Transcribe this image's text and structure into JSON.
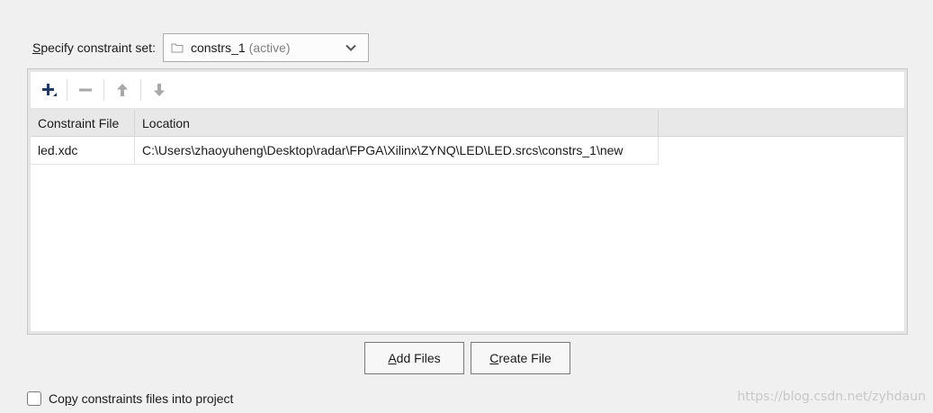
{
  "constraint_set": {
    "label_hotkey": "S",
    "label_rest": "pecify constraint set:",
    "value": "constrs_1",
    "active_tag": "(active)",
    "icons": {
      "folder": "folder-icon",
      "chevron": "chevron-down-icon"
    }
  },
  "toolbar": {
    "icons": [
      "add-icon",
      "remove-icon",
      "move-up-icon",
      "move-down-icon"
    ]
  },
  "table": {
    "headers": [
      "Constraint File",
      "Location",
      ""
    ],
    "rows": [
      [
        "led.xdc",
        "C:\\Users\\zhaoyuheng\\Desktop\\radar\\FPGA\\Xilinx\\ZYNQ\\LED\\LED.srcs\\constrs_1\\new",
        ""
      ]
    ]
  },
  "buttons": {
    "add_files_hotkey": "A",
    "add_files_rest": "dd Files",
    "create_file_hotkey": "C",
    "create_file_rest": "reate File"
  },
  "copy_checkbox": {
    "label_pre": "Co",
    "label_hotkey": "p",
    "label_rest": "y constraints files into project",
    "checked": false
  },
  "watermark": "https://blog.csdn.net/zyhdaun",
  "colors": {
    "panel_bg": "#e6e6e6",
    "header_bg": "#e8e8e8",
    "add_icon": "#1f3a68",
    "disabled_icon": "#a8a8a8"
  }
}
